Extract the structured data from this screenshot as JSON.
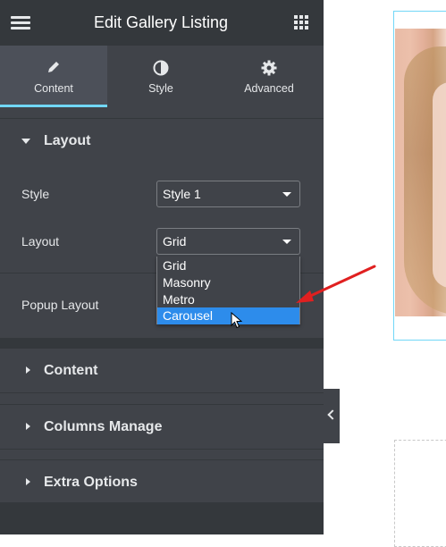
{
  "header": {
    "title": "Edit Gallery Listing",
    "menu_icon": "hamburger-menu-icon",
    "grid_icon": "apps-grid-icon"
  },
  "tabs": [
    {
      "label": "Content",
      "icon": "pencil-icon",
      "active": true
    },
    {
      "label": "Style",
      "icon": "half-circle-contrast-icon",
      "active": false
    },
    {
      "label": "Advanced",
      "icon": "gear-icon",
      "active": false
    }
  ],
  "layout_section": {
    "title": "Layout",
    "expanded": true,
    "controls": {
      "style": {
        "label": "Style",
        "value": "Style 1"
      },
      "layout": {
        "label": "Layout",
        "value": "Grid",
        "options": [
          "Grid",
          "Masonry",
          "Metro",
          "Carousel"
        ],
        "highlighted": "Carousel"
      },
      "popup_layout": {
        "label": "Popup Layout"
      }
    }
  },
  "collapsed_sections": [
    {
      "title": "Content"
    },
    {
      "title": "Columns Manage"
    },
    {
      "title": "Extra Options"
    }
  ],
  "colors": {
    "panel_bg": "#404349",
    "panel_dark": "#34383c",
    "accent": "#71d7f7",
    "option_highlight": "#2d8ceb",
    "annotation_arrow": "#e02020"
  }
}
